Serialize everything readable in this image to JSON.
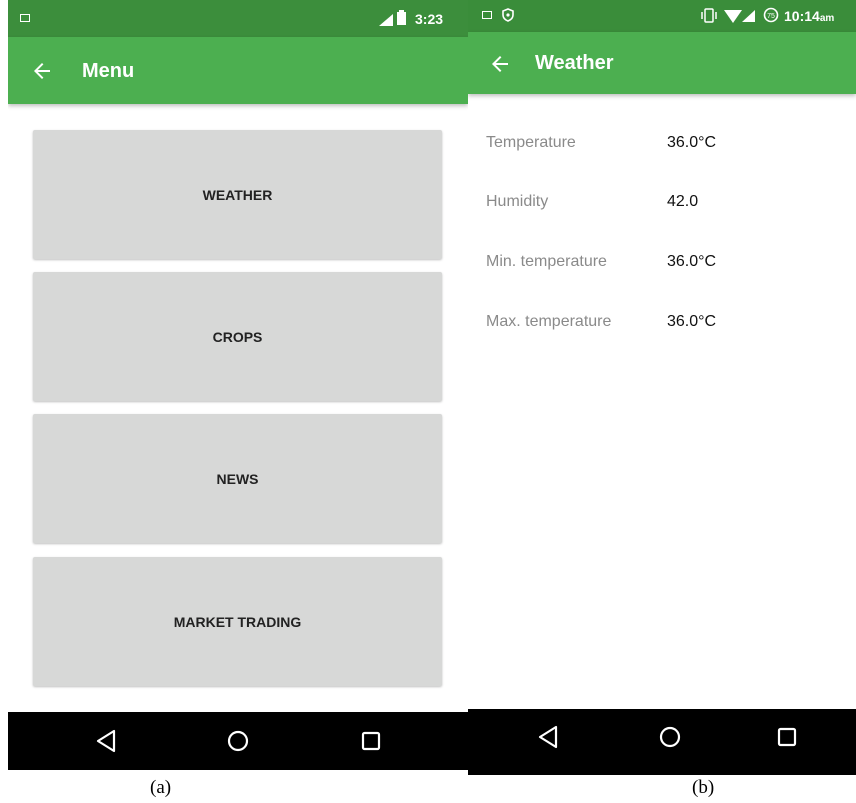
{
  "screen_a": {
    "status_bar": {
      "time": "3:23",
      "icons": [
        "image-icon",
        "signal-icon",
        "battery-icon"
      ]
    },
    "app_bar": {
      "title": "Menu",
      "back_icon": "arrow-left-icon"
    },
    "menu_items": [
      {
        "label": "WEATHER"
      },
      {
        "label": "CROPS"
      },
      {
        "label": "NEWS"
      },
      {
        "label": "MARKET TRADING"
      }
    ],
    "nav_bar": {
      "icons": [
        "back-triangle-icon",
        "home-circle-icon",
        "recents-square-icon"
      ]
    },
    "caption": "(a)"
  },
  "screen_b": {
    "status_bar": {
      "time": "10:14",
      "time_suffix": "am",
      "icons": [
        "image-icon",
        "shield-icon",
        "vibrate-icon",
        "wifi-icon",
        "signal-icon",
        "alarm-icon"
      ]
    },
    "app_bar": {
      "title": "Weather",
      "back_icon": "arrow-left-icon"
    },
    "rows": [
      {
        "label": "Temperature",
        "value": "36.0°C"
      },
      {
        "label": "Humidity",
        "value": "42.0"
      },
      {
        "label": "Min. temperature",
        "value": "36.0°C"
      },
      {
        "label": "Max. temperature",
        "value": "36.0°C"
      }
    ],
    "nav_bar": {
      "icons": [
        "back-triangle-icon",
        "home-circle-icon",
        "recents-square-icon"
      ]
    },
    "caption": "(b)"
  },
  "colors": {
    "app_bar": "#4caf50",
    "status_bar": "#3c8e3c",
    "menu_button": "#d7d8d7",
    "nav_bar": "#000000"
  }
}
